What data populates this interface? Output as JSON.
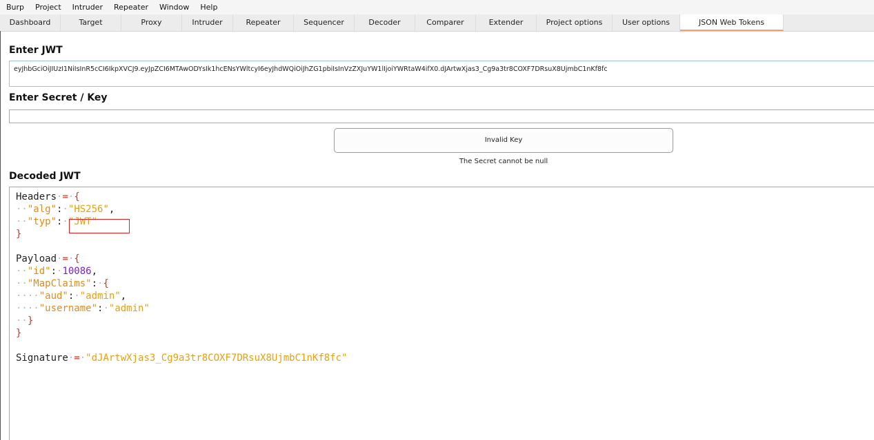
{
  "menu": [
    "Burp",
    "Project",
    "Intruder",
    "Repeater",
    "Window",
    "Help"
  ],
  "tabs": [
    {
      "label": "Dashboard",
      "active": false
    },
    {
      "label": "Target",
      "active": false
    },
    {
      "label": "Proxy",
      "active": false
    },
    {
      "label": "Intruder",
      "active": false
    },
    {
      "label": "Repeater",
      "active": false
    },
    {
      "label": "Sequencer",
      "active": false
    },
    {
      "label": "Decoder",
      "active": false
    },
    {
      "label": "Comparer",
      "active": false
    },
    {
      "label": "Extender",
      "active": false
    },
    {
      "label": "Project options",
      "active": false
    },
    {
      "label": "User options",
      "active": false
    },
    {
      "label": "JSON Web Tokens",
      "active": true
    }
  ],
  "enter_jwt": {
    "title": "Enter JWT",
    "value": "eyJhbGciOiJIUzI1NiIsInR5cCI6IkpXVCJ9.eyJpZCI6MTAwODYsIk1hcENsYWltcyI6eyJhdWQiOiJhZG1pbiIsInVzZXJuYW1lIjoiYWRtaW4ifX0.dJArtwXjas3_Cg9a3tr8COXF7DRsuX8UjmbC1nKf8fc"
  },
  "secret": {
    "title": "Enter Secret / Key",
    "value": ""
  },
  "key_status": {
    "button_label": "Invalid Key",
    "message": "The Secret cannot be null"
  },
  "decoded": {
    "title": "Decoded JWT",
    "headers_label": "Headers",
    "alg_key": "\"alg\"",
    "alg_value": "\"HS256\"",
    "typ_key": "\"typ\"",
    "typ_value": "\"JWT\"",
    "payload_label": "Payload",
    "id_key": "\"id\"",
    "id_value": "10086",
    "mapclaims_key": "\"MapClaims\"",
    "aud_key": "\"aud\"",
    "aud_value": "\"admin\"",
    "username_key": "\"username\"",
    "username_value": "\"admin\"",
    "signature_label": "Signature",
    "signature_value": "\"dJArtwXjas3_Cg9a3tr8COXF7DRsuX8UjmbC1nKf8fc\""
  },
  "colors": {
    "active_tab_underline": "#f0a070",
    "highlight_box": "#e02020",
    "code_key": "#e88a10",
    "code_number": "#7a20d0",
    "code_brace": "#e03020"
  }
}
